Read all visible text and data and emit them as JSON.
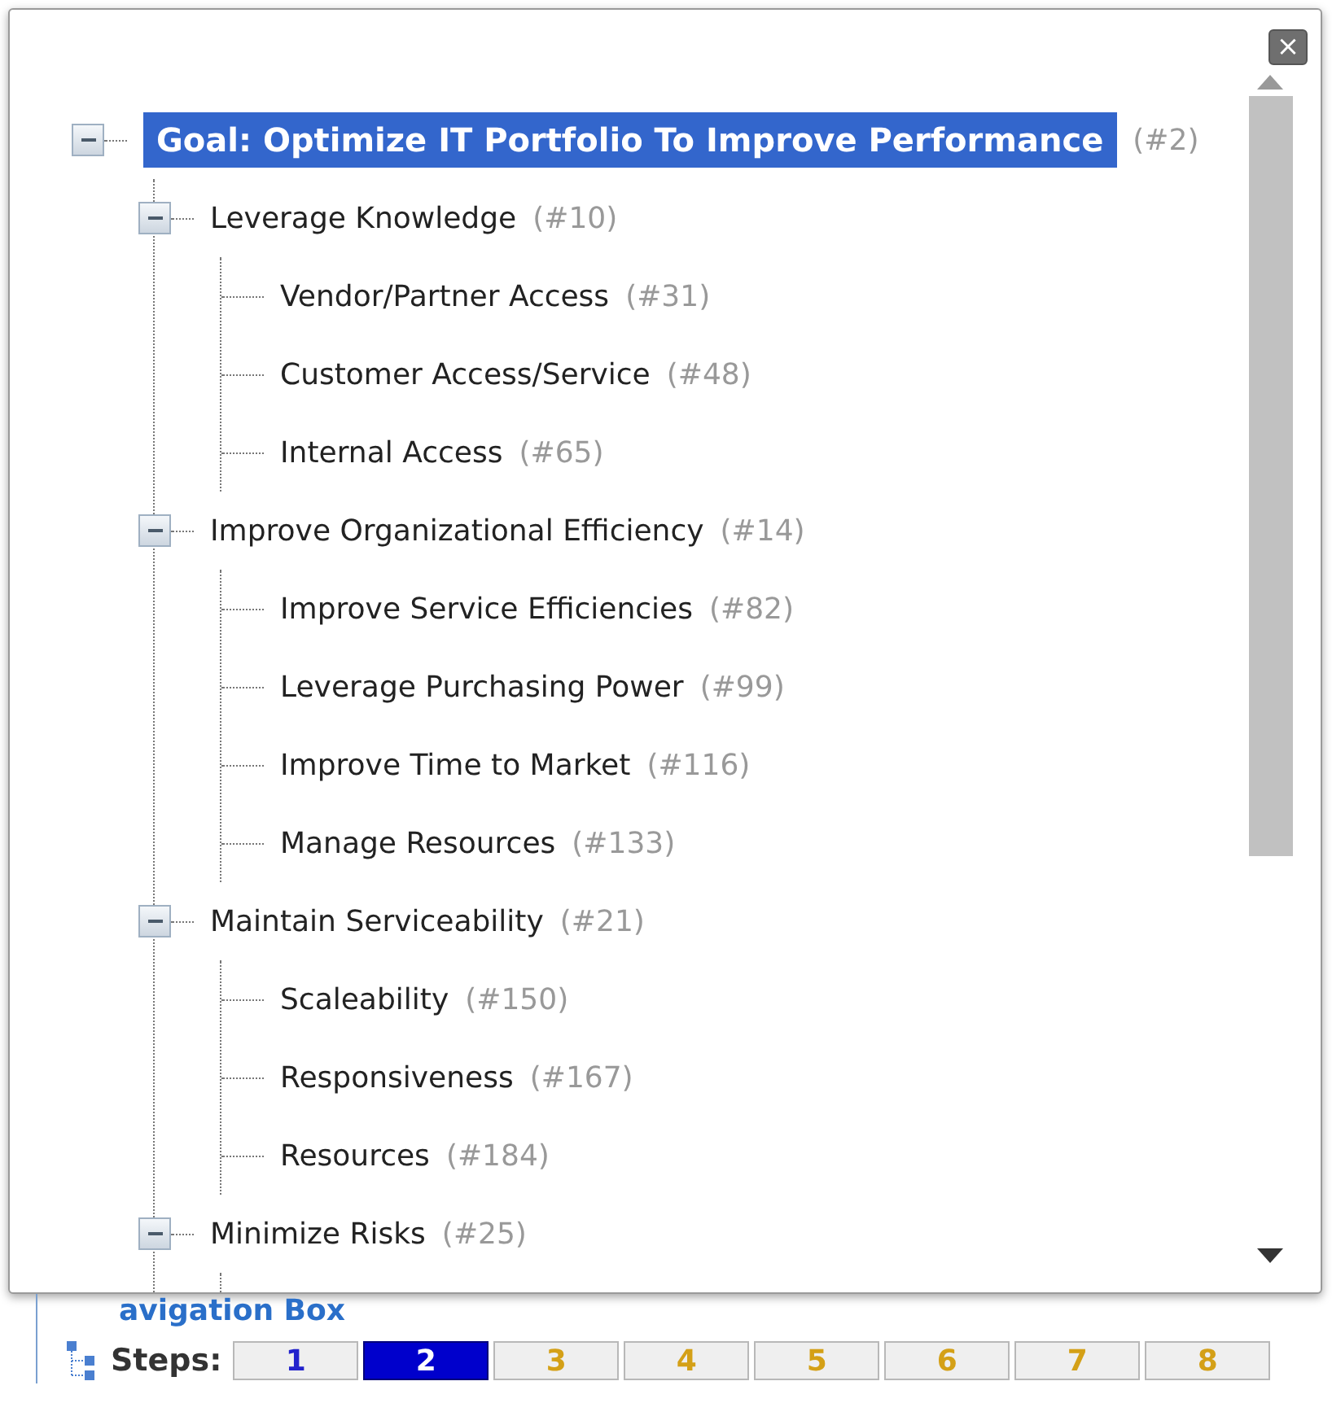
{
  "popup": {
    "close_label": "×"
  },
  "tree": [
    {
      "label": "Goal: Optimize IT Portfolio To Improve Performance",
      "count": "(#2)",
      "selected": true,
      "expanded": true,
      "children": [
        {
          "label": "Leverage Knowledge",
          "count": "(#10)",
          "selected": false,
          "expanded": true,
          "children": [
            {
              "label": "Vendor/Partner Access",
              "count": "(#31)",
              "selected": false
            },
            {
              "label": "Customer Access/Service",
              "count": "(#48)",
              "selected": false
            },
            {
              "label": "Internal Access",
              "count": "(#65)",
              "selected": false
            }
          ]
        },
        {
          "label": "Improve Organizational Efficiency",
          "count": "(#14)",
          "selected": false,
          "expanded": true,
          "children": [
            {
              "label": "Improve Service Efficiencies",
              "count": "(#82)",
              "selected": false
            },
            {
              "label": "Leverage Purchasing Power",
              "count": "(#99)",
              "selected": false
            },
            {
              "label": "Improve Time to Market",
              "count": "(#116)",
              "selected": false
            },
            {
              "label": "Manage Resources",
              "count": "(#133)",
              "selected": false
            }
          ]
        },
        {
          "label": "Maintain Serviceability",
          "count": "(#21)",
          "selected": false,
          "expanded": true,
          "children": [
            {
              "label": "Scaleability",
              "count": "(#150)",
              "selected": false
            },
            {
              "label": "Responsiveness",
              "count": "(#167)",
              "selected": false
            },
            {
              "label": "Resources",
              "count": "(#184)",
              "selected": false
            }
          ]
        },
        {
          "label": "Minimize Risks",
          "count": "(#25)",
          "selected": false,
          "expanded": true
        }
      ]
    }
  ],
  "navigation": {
    "title": "avigation Box",
    "steps_label": "Steps:",
    "steps": [
      {
        "label": "1",
        "selected": false,
        "visited": true
      },
      {
        "label": "2",
        "selected": true
      },
      {
        "label": "3",
        "selected": false,
        "visited": false
      },
      {
        "label": "4",
        "selected": false,
        "visited": false
      },
      {
        "label": "5",
        "selected": false,
        "visited": false
      },
      {
        "label": "6",
        "selected": false,
        "visited": false
      },
      {
        "label": "7",
        "selected": false,
        "visited": false
      },
      {
        "label": "8",
        "selected": false,
        "visited": false
      }
    ]
  }
}
